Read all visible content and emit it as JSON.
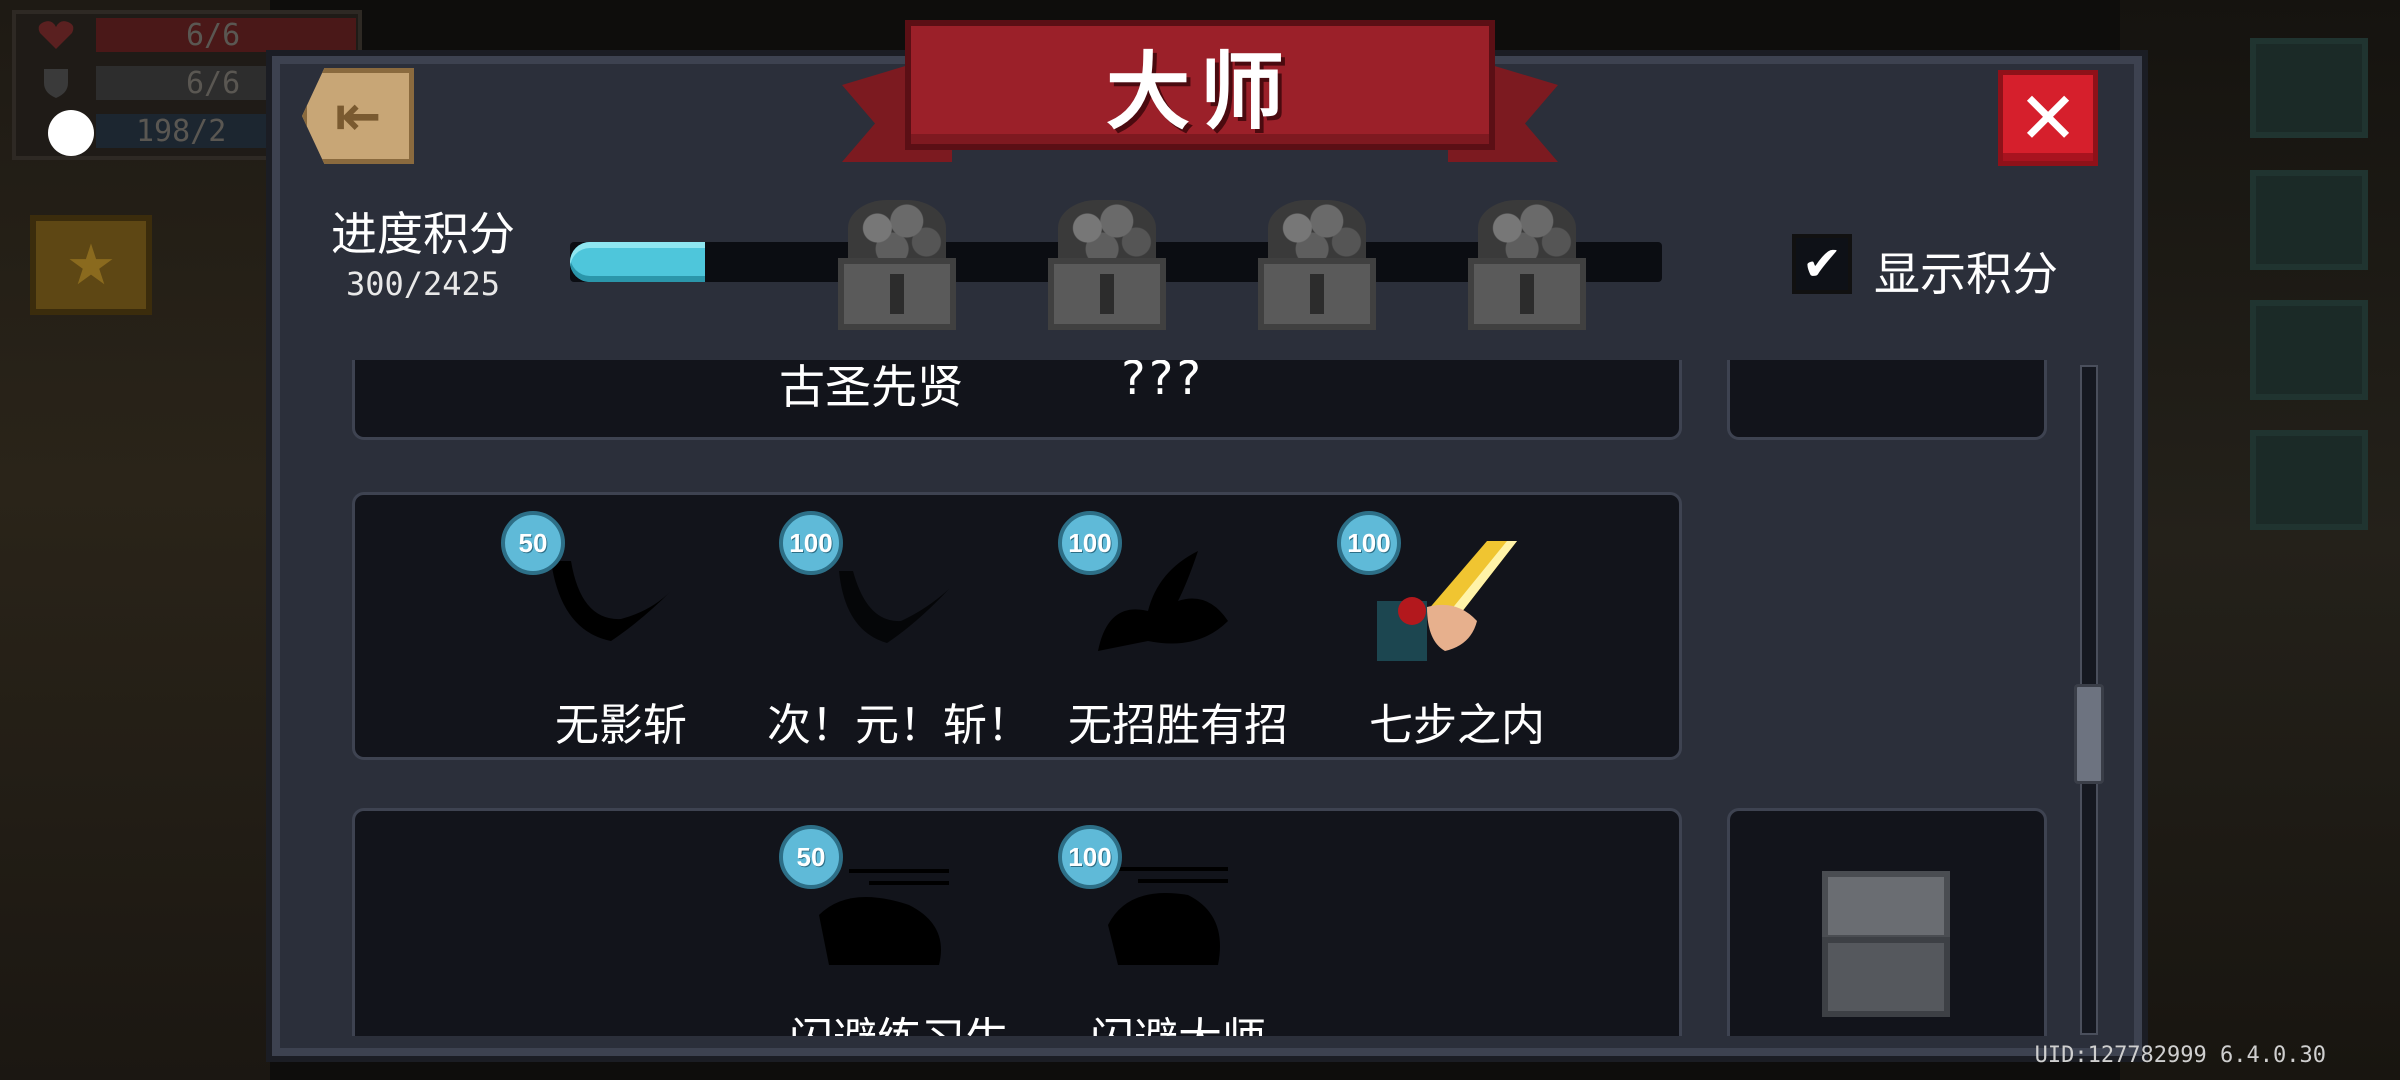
{
  "hud": {
    "health": "6/6",
    "armor": "6/6",
    "energy": "198/2"
  },
  "dialog": {
    "title": "大师",
    "back_icon": "exit-icon",
    "close_icon": "close-icon"
  },
  "progress": {
    "label": "进度积分",
    "value_text": "300/2425",
    "current": 300,
    "total": 2425,
    "milestones": 4
  },
  "toggle": {
    "checked": true,
    "label": "显示积分"
  },
  "rows": [
    {
      "labels": [
        "古圣先贤",
        "???"
      ]
    },
    {
      "achievements": [
        {
          "badge": "50",
          "name": "无影斩",
          "unlocked": false
        },
        {
          "badge": "100",
          "name": "次！元！斩！",
          "unlocked": false
        },
        {
          "badge": "100",
          "name": "无招胜有招",
          "unlocked": false
        },
        {
          "badge": "100",
          "name": "七步之内",
          "unlocked": true
        }
      ]
    },
    {
      "achievements": [
        {
          "badge": "50",
          "name": "闪避练习生",
          "unlocked": false
        },
        {
          "badge": "100",
          "name": "闪避大师",
          "unlocked": false
        }
      ]
    }
  ],
  "footer": {
    "uid": "UID:127782999 6.4.0.30"
  },
  "colors": {
    "accent": "#4ec6db",
    "banner": "#9b2029",
    "close": "#d61f2c",
    "panel": "#2b2f3a",
    "card": "#12141b"
  }
}
